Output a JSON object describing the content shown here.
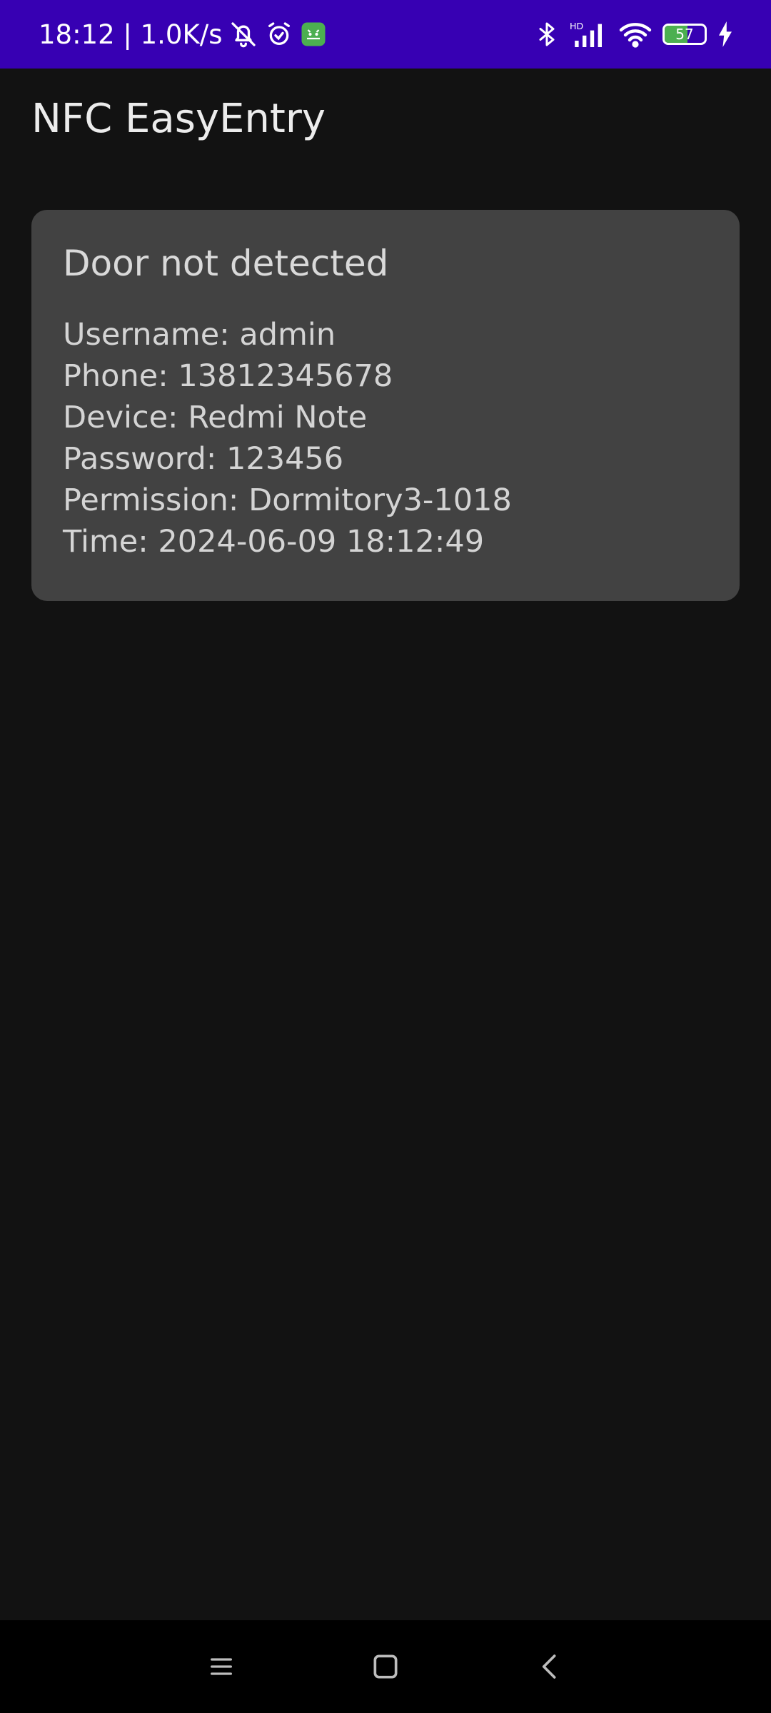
{
  "status_bar": {
    "time_speed": "18:12 | 1.0K/s",
    "battery_level": "57",
    "battery_fraction": 0.57,
    "icons": [
      "bell-off-icon",
      "alarm-icon",
      "android-app-icon",
      "bluetooth-icon",
      "hd-signal-icon",
      "wifi-icon",
      "battery-icon",
      "charging-icon"
    ],
    "background_color": "#3700b3"
  },
  "app": {
    "title": "NFC EasyEntry"
  },
  "card": {
    "title": "Door not detected",
    "lines": {
      "username": "Username: admin",
      "phone": "Phone: 13812345678",
      "device": "Device: Redmi Note",
      "password": "Password: 123456",
      "permission": "Permission: Dormitory3-1018",
      "time": "Time: 2024-06-09 18:12:49"
    }
  },
  "nav_bar": {
    "buttons": [
      "menu-icon",
      "home-icon",
      "back-icon"
    ]
  }
}
